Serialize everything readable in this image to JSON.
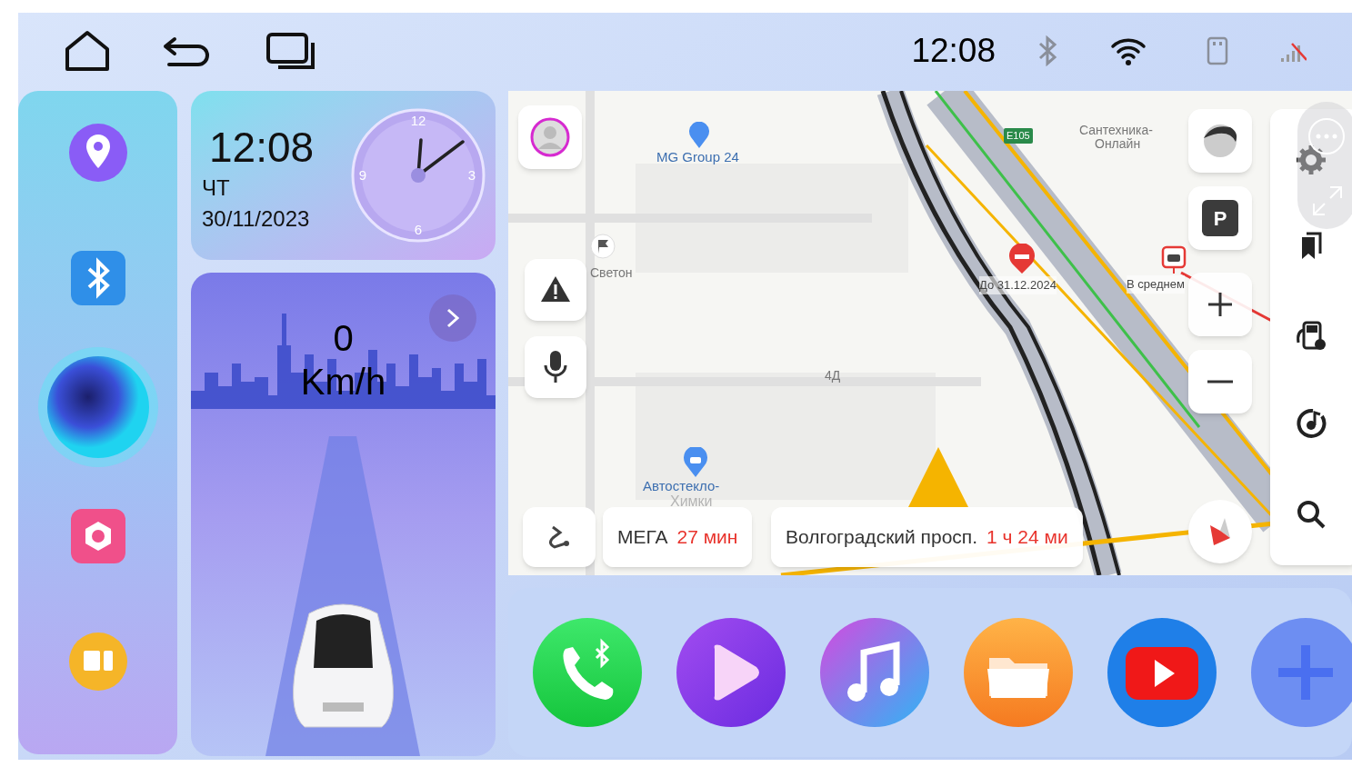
{
  "status_bar": {
    "time": "12:08",
    "bluetooth_on": false
  },
  "clock_widget": {
    "time": "12:08",
    "weekday": "ЧТ",
    "date": "30/11/2023",
    "dial_numbers": [
      "12",
      "3",
      "6",
      "9"
    ]
  },
  "speed_widget": {
    "value": "0",
    "unit": "Km/h"
  },
  "map": {
    "labels": [
      {
        "kind": "poi",
        "text": "MG Group 24"
      },
      {
        "kind": "place",
        "text": "Светон"
      },
      {
        "kind": "place",
        "text": "4Д"
      },
      {
        "kind": "poi",
        "text": "Автостекло-"
      },
      {
        "kind": "faded",
        "text": "Химки"
      },
      {
        "kind": "place",
        "text": "Сантехника-"
      },
      {
        "kind": "place",
        "text": "Онлайн"
      },
      {
        "kind": "road_sign",
        "text": "E105"
      },
      {
        "kind": "event",
        "text": "До 31.12.2024"
      },
      {
        "kind": "event",
        "text": "В среднем"
      }
    ],
    "parking_label": "P",
    "routes": [
      {
        "destination": "МЕГА",
        "eta": "27 мин"
      },
      {
        "destination": "Волгоградский просп.",
        "eta": "1 ч 24 ми"
      }
    ]
  }
}
